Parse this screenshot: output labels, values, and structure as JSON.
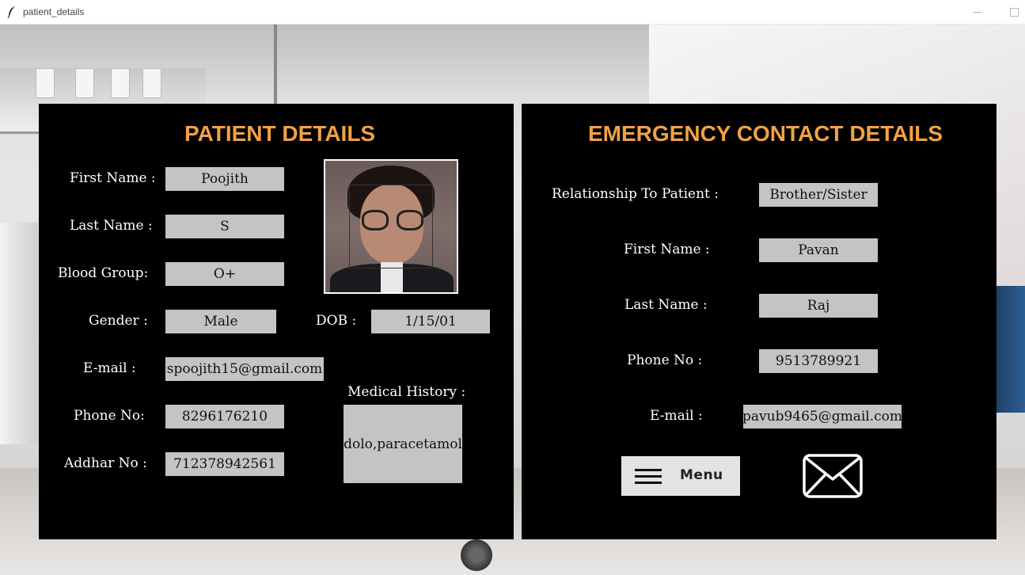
{
  "window": {
    "title": "patient_details"
  },
  "patient": {
    "heading": "PATIENT DETAILS",
    "labels": {
      "first_name": "First Name :",
      "last_name": "Last Name :",
      "blood_group": "Blood Group:",
      "gender": "Gender :",
      "dob": "DOB :",
      "email": "E-mail :",
      "phone": "Phone No:",
      "addhar": "Addhar No :",
      "medical_history": "Medical History :"
    },
    "values": {
      "first_name": "Poojith",
      "last_name": "S",
      "blood_group": "O+",
      "gender": "Male",
      "dob": "1/15/01",
      "email": "spoojith15@gmail.com",
      "phone": "8296176210",
      "addhar": "712378942561",
      "medical_history": "dolo,paracetamol"
    }
  },
  "emergency": {
    "heading": "EMERGENCY CONTACT DETAILS",
    "labels": {
      "relationship": "Relationship To Patient :",
      "first_name": "First Name :",
      "last_name": "Last Name :",
      "phone": "Phone No :",
      "email": "E-mail :"
    },
    "values": {
      "relationship": "Brother/Sister",
      "first_name": "Pavan",
      "last_name": "Raj",
      "phone": "9513789921",
      "email": "pavub9465@gmail.com"
    }
  },
  "actions": {
    "menu_label": "Menu"
  },
  "icons": {
    "app": "feather-icon",
    "menu": "hamburger-icon",
    "mail": "envelope-icon",
    "photo": "patient-photo"
  },
  "colors": {
    "heading": "#f0a244",
    "panel": "#000000",
    "field": "#c4c4c4"
  }
}
